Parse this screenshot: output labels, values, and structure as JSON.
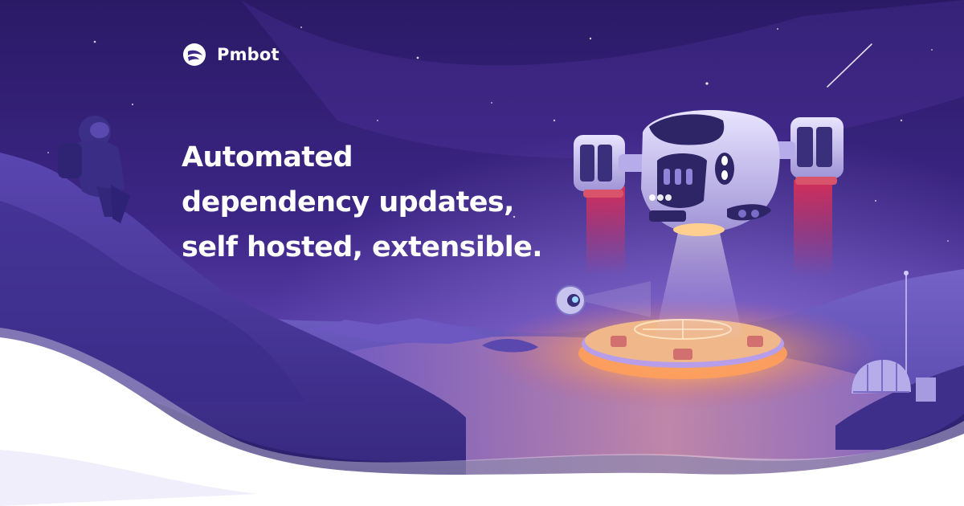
{
  "brand": {
    "name": "Pmbot",
    "logo_icon": "pmbot-logo-icon"
  },
  "hero": {
    "headline_lines": [
      "Automated",
      "dependency updates,",
      "self hosted, extensible."
    ]
  },
  "colors": {
    "sky_top": "#2a1a66",
    "sky_mid": "#4b2f9a",
    "horizon": "#7d5ed1",
    "terrain": "#4a3aa0",
    "pad_glow": "#ffb35c",
    "thruster": "#ff3b4a",
    "text": "#ffffff"
  }
}
